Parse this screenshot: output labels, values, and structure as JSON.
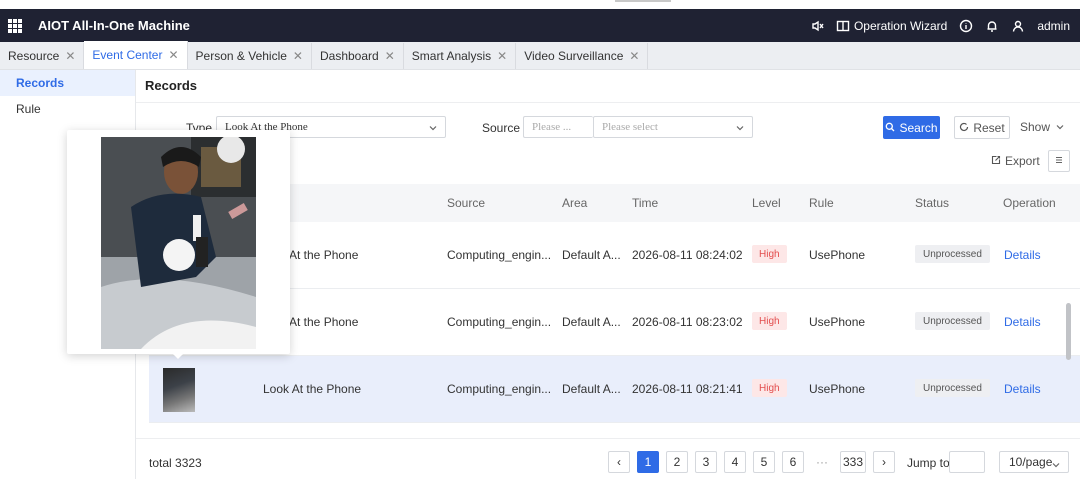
{
  "app": {
    "title": "AIOT All-In-One Machine"
  },
  "header": {
    "wizard_label": "Operation Wizard",
    "user": "admin"
  },
  "tabs": [
    {
      "label": "Resource",
      "active": false
    },
    {
      "label": "Event Center",
      "active": true
    },
    {
      "label": "Person & Vehicle",
      "active": false
    },
    {
      "label": "Dashboard",
      "active": false
    },
    {
      "label": "Smart Analysis",
      "active": false
    },
    {
      "label": "Video Surveillance",
      "active": false
    }
  ],
  "sidebar": {
    "items": [
      {
        "label": "Records",
        "active": true
      },
      {
        "label": "Rule",
        "active": false
      }
    ]
  },
  "page": {
    "title": "Records"
  },
  "filters": {
    "type_label": "Type",
    "type_value": "Look At the Phone",
    "source_label": "Source",
    "source_placeholder_1": "Please ...",
    "source_placeholder_2": "Please select",
    "search_label": "Search",
    "reset_label": "Reset",
    "show_label": "Show"
  },
  "toolbar": {
    "export_label": "Export"
  },
  "table": {
    "columns": {
      "source": "Source",
      "area": "Area",
      "time": "Time",
      "level": "Level",
      "rule": "Rule",
      "status": "Status",
      "operation": "Operation"
    },
    "rows": [
      {
        "type": "At the Phone",
        "source": "Computing_engin...",
        "area": "Default A...",
        "time": "2026-08-11 08:24:02",
        "level": "High",
        "rule": "UsePhone",
        "status": "Unprocessed",
        "op": "Details"
      },
      {
        "type": "At the Phone",
        "source": "Computing_engin...",
        "area": "Default A...",
        "time": "2026-08-11 08:23:02",
        "level": "High",
        "rule": "UsePhone",
        "status": "Unprocessed",
        "op": "Details"
      },
      {
        "type": "Look At the Phone",
        "source": "Computing_engin...",
        "area": "Default A...",
        "time": "2026-08-11 08:21:41",
        "level": "High",
        "rule": "UsePhone",
        "status": "Unprocessed",
        "op": "Details"
      }
    ]
  },
  "pagination": {
    "total": "total 3323",
    "pages": [
      "1",
      "2",
      "3",
      "4",
      "5",
      "6"
    ],
    "ellipsis": "···",
    "last_page": "333",
    "prev": "‹",
    "next": "›",
    "jump_label": "Jump to",
    "page_size": "10/page"
  },
  "colors": {
    "accent": "#2f6be6",
    "header_bg": "#1f2233",
    "level_high": "#e34d4d"
  }
}
